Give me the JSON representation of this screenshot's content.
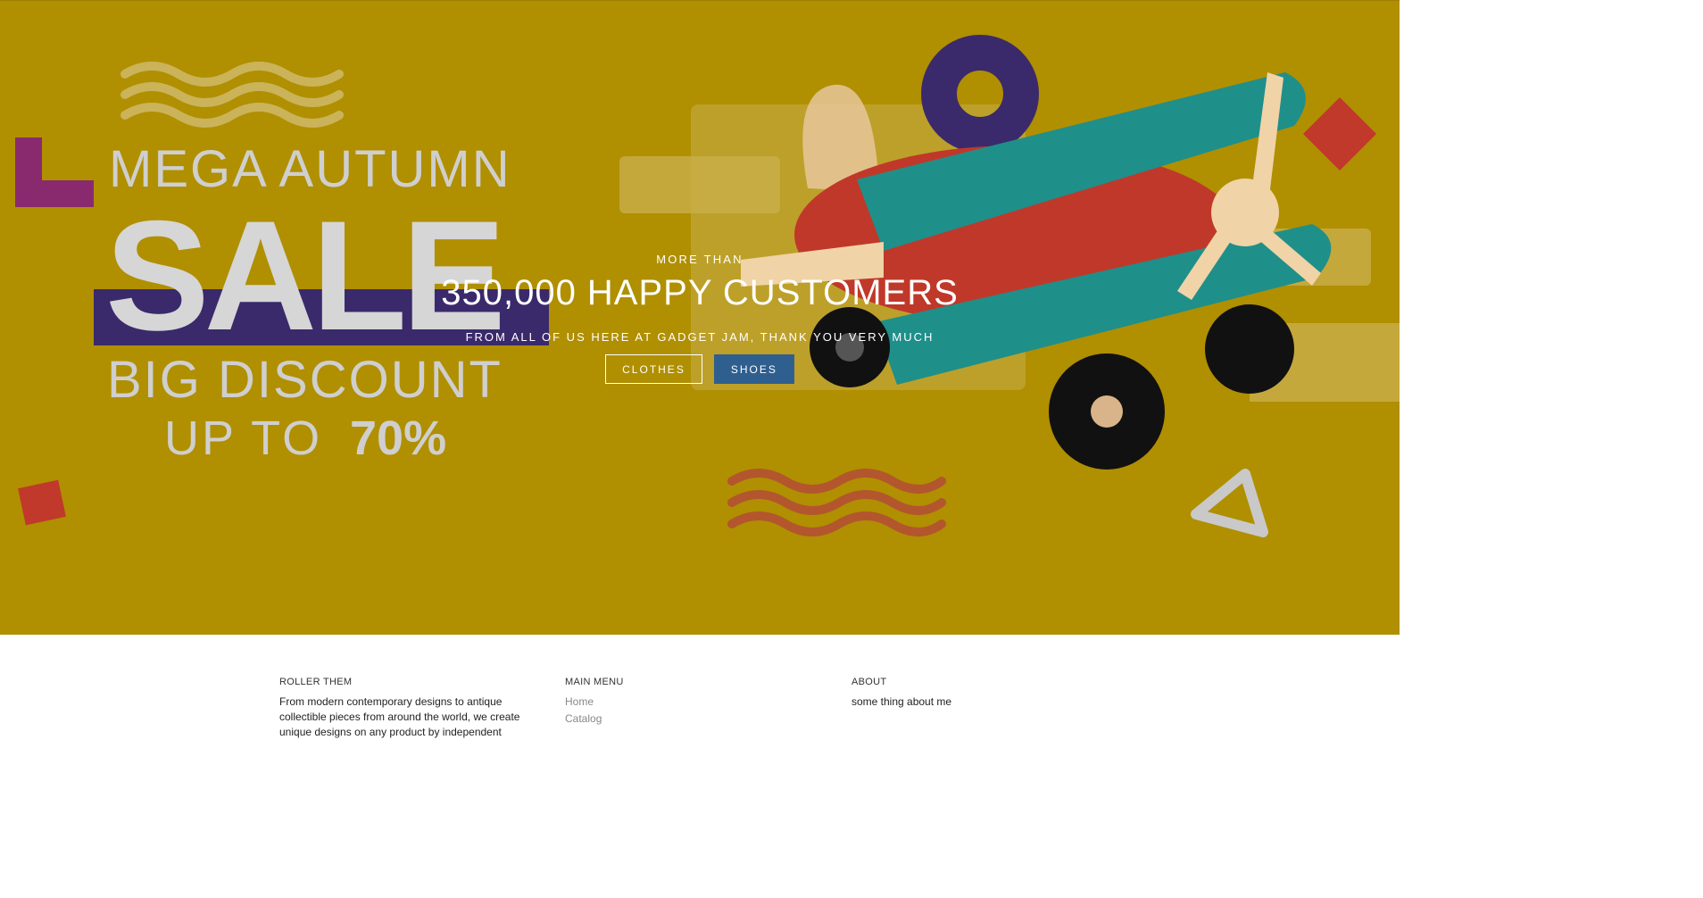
{
  "hero": {
    "banner_line1": "MEGA AUTUMN",
    "banner_line2": "SALE",
    "banner_line3": "BIG DISCOUNT",
    "banner_line4": "UP TO",
    "banner_percent": "70%",
    "eyebrow": "MORE THAN",
    "headline": "350,000 HAPPY CUSTOMERS",
    "subheadline": "FROM ALL OF US HERE AT GADGET JAM, THANK YOU VERY MUCH",
    "buttons": [
      {
        "label": "CLOTHES"
      },
      {
        "label": "SHOES"
      }
    ]
  },
  "footer": {
    "col1": {
      "title": "ROLLER THEM",
      "text": "From modern contemporary designs to antique collectible pieces from around the world, we create unique designs on any product by independent"
    },
    "col2": {
      "title": "MAIN MENU",
      "links": [
        "Home",
        "Catalog"
      ]
    },
    "col3": {
      "title": "ABOUT",
      "text": "some thing about me"
    }
  },
  "colors": {
    "hero_bg": "#b08f00",
    "button_solid": "#2f5f8f",
    "banner_bar": "#3a2a6b"
  }
}
